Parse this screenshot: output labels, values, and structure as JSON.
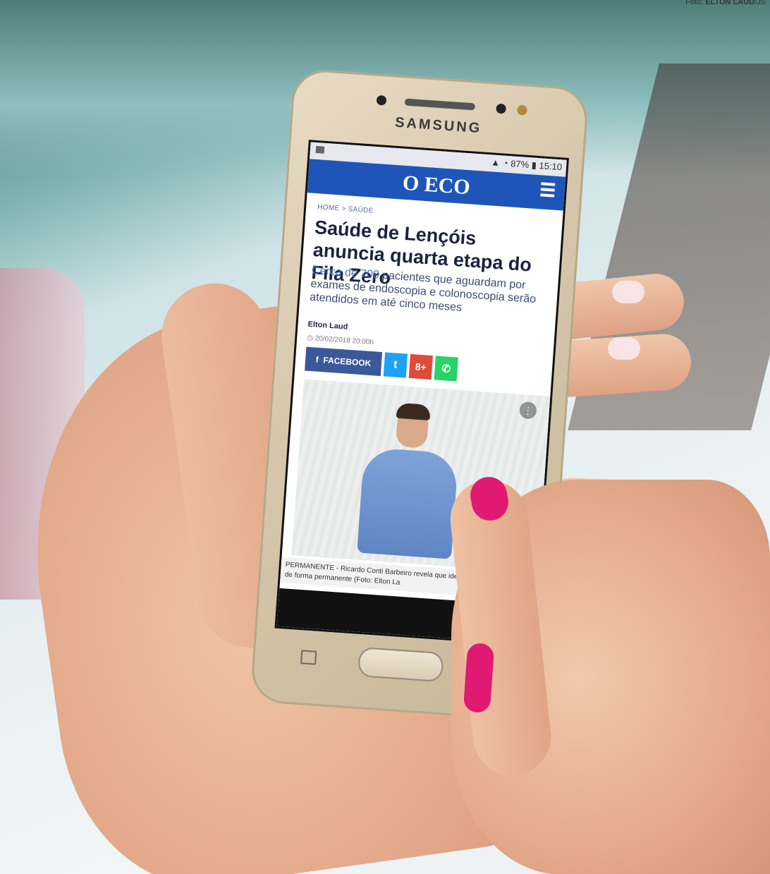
{
  "photo_credit": {
    "prefix": "Foto: ",
    "name": "ELTON LAUD",
    "suffix": "/JS"
  },
  "phone": {
    "brand": "SAMSUNG",
    "status": {
      "battery": "87%",
      "time": "15:10"
    },
    "app": {
      "logo": "O ECO",
      "breadcrumb": "HOME > SAÚDE",
      "headline": "Saúde de Lençóis anuncia quarta etapa do Fila Zero",
      "subtitle_lead": "Cerca de 700",
      "subtitle_rest": " pacientes que aguardam por exames de endoscopia e colonoscopia serão atendidos em até cinco meses",
      "author": "Elton Laud",
      "date": "20/02/2018 20:00h",
      "share": {
        "facebook": "FACEBOOK",
        "twitter": "t",
        "gplus": "8+",
        "whatsapp": "✆"
      },
      "caption": "PERMANENTE - Ricardo Conti Barbeiro revela que ideia programa Fila Zero de forma permanente (Foto: Elton La"
    }
  }
}
